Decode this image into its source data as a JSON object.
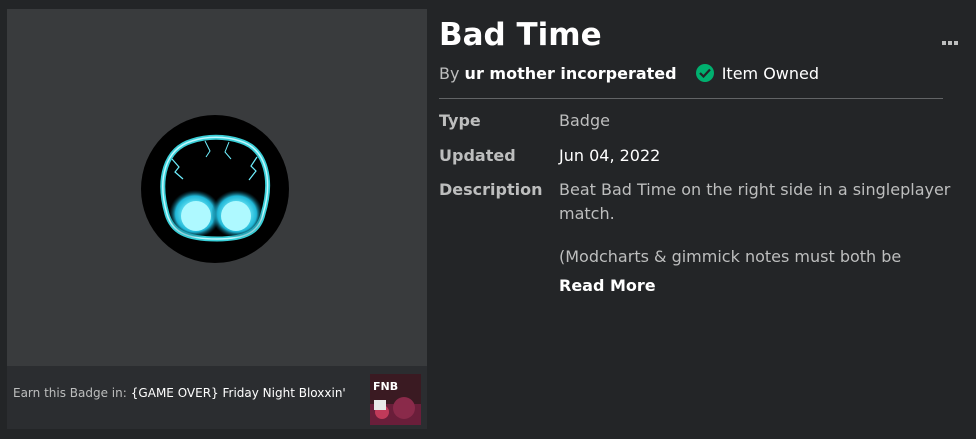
{
  "badge": {
    "title": "Bad Time",
    "by_prefix": "By",
    "creator": "ur mother incorperated",
    "owned_status": "Item Owned",
    "icon": "glowing-eyes-badge-image"
  },
  "details": {
    "type_label": "Type",
    "type_value": "Badge",
    "updated_label": "Updated",
    "updated_value": "Jun 04, 2022",
    "description_label": "Description",
    "description_lines": [
      "Beat Bad Time on the right side in a singleplayer",
      "match.",
      "(Modcharts & gimmick notes must both be"
    ],
    "read_more": "Read More"
  },
  "earn": {
    "prefix": "Earn this Badge in:",
    "game_name": "{GAME OVER} Friday Night Bloxxin'",
    "game_thumbnail_text": "FNB"
  },
  "colors": {
    "background": "#232527",
    "panel": "#393b3d",
    "owned_green": "#00b06f",
    "glow": "#3fe6f0"
  }
}
